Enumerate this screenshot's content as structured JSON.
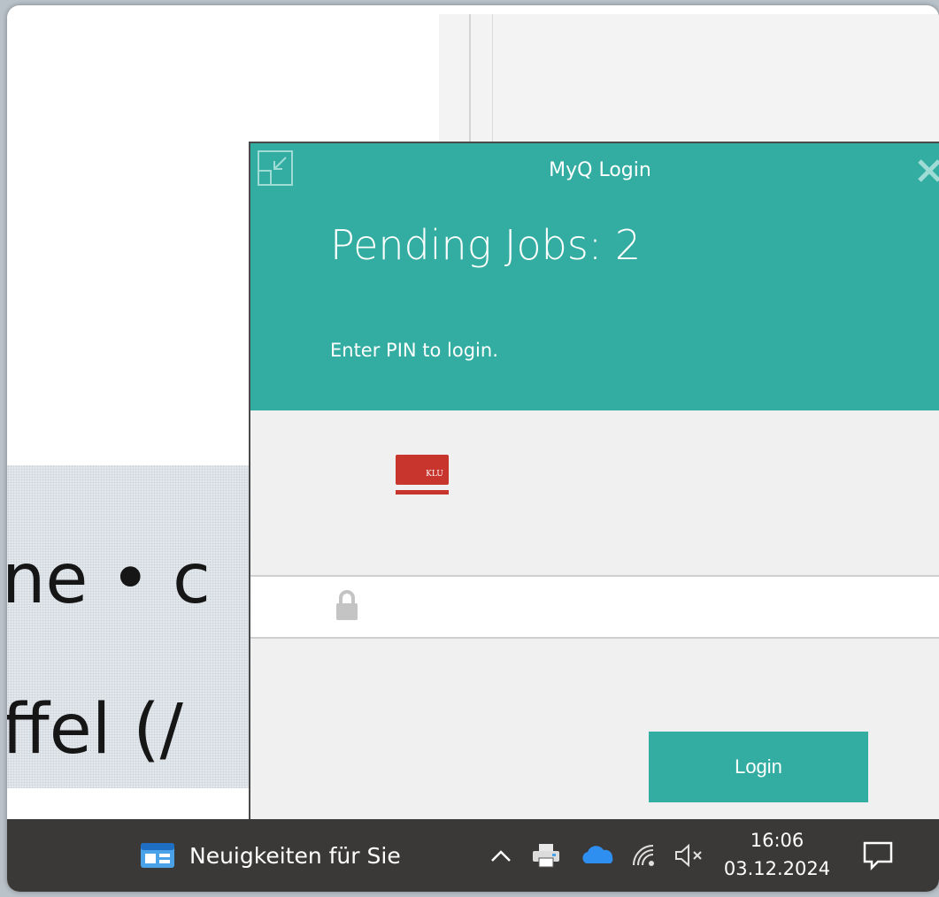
{
  "background": {
    "doc_line_1": "ne • c",
    "doc_line_2": "ffel (/"
  },
  "dialog": {
    "title": "MyQ Login",
    "pending_jobs": "Pending Jobs: 2",
    "instruction": "Enter PIN to login.",
    "card_label": "KLU",
    "pin_value": "",
    "login_label": "Login",
    "accent_color": "#33ada2"
  },
  "taskbar": {
    "news_label": "Neuigkeiten für Sie",
    "time": "16:06",
    "date": "03.12.2024",
    "tray_icons": [
      "chevron-up-icon",
      "printer-icon",
      "onedrive-cloud-icon",
      "network-icon",
      "volume-muted-icon"
    ]
  }
}
